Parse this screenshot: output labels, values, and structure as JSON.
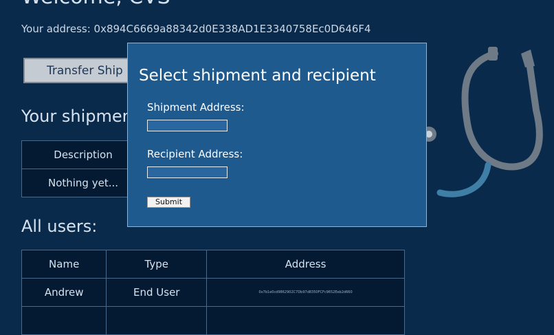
{
  "header": {
    "welcome": "Welcome, CVS",
    "address_line": "Your address: 0x894C6669a88342d0E338AD1E3340758Ec0D646F4"
  },
  "actions": {
    "transfer_label": "Transfer Ship"
  },
  "shipments": {
    "heading": "Your shipmen",
    "columns": [
      "Description"
    ],
    "rows": [
      [
        "Nothing yet..."
      ]
    ]
  },
  "users": {
    "heading": "All users:",
    "columns": [
      "Name",
      "Type",
      "Address"
    ],
    "rows": [
      [
        "Andrew",
        "End User",
        "0x7b1e0cd9862902C7Db97d8350FCFc9652Eeb2d660"
      ]
    ]
  },
  "modal": {
    "title": "Select shipment and recipient",
    "shipment_label": "Shipment Address:",
    "shipment_value": "",
    "recipient_label": "Recipient Address:",
    "recipient_value": "",
    "submit_label": "Submit"
  },
  "icons": {
    "decoration": "stethoscope-icon"
  }
}
